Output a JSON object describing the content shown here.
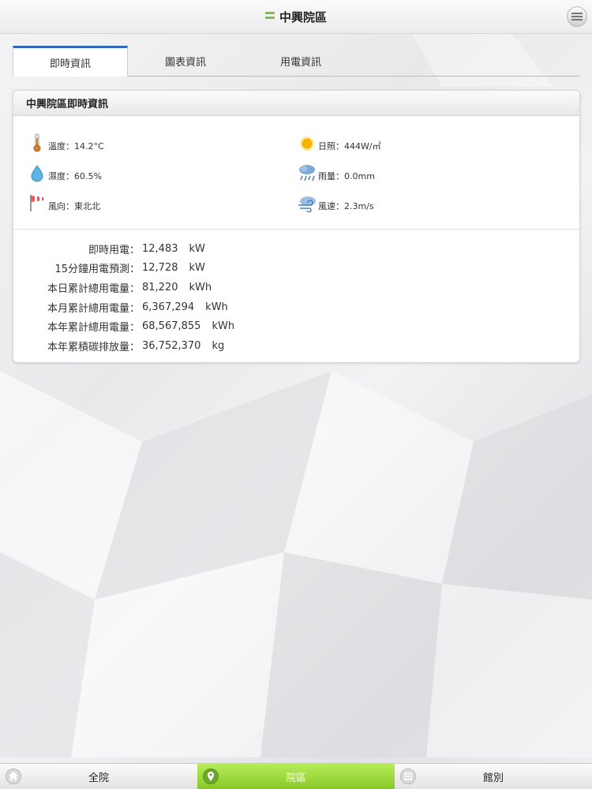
{
  "header": {
    "title": "中興院區"
  },
  "tabs": [
    {
      "label": "即時資訊",
      "active": true
    },
    {
      "label": "圖表資訊",
      "active": false
    },
    {
      "label": "用電資訊",
      "active": false
    }
  ],
  "panel": {
    "title": "中興院區即時資訊",
    "weather": {
      "temperature": "溫度：14.2°C",
      "humidity": "濕度：60.5%",
      "wind_direction": "風向：東北北",
      "sunshine": "日照：444W/㎡",
      "rainfall": "雨量：0.0mm",
      "wind_speed": "風速：2.3m/s"
    },
    "energy": [
      {
        "label": "即時用電：",
        "value": "12,483",
        "unit": "kW"
      },
      {
        "label": "15分鐘用電預測：",
        "value": "12,728",
        "unit": "kW"
      },
      {
        "label": "本日累計總用電量：",
        "value": "81,220",
        "unit": "kWh"
      },
      {
        "label": "本月累計總用電量：",
        "value": "6,367,294",
        "unit": "kWh"
      },
      {
        "label": "本年累計總用電量：",
        "value": "68,567,855",
        "unit": "kWh"
      },
      {
        "label": "本年累積碳排放量：",
        "value": "36,752,370",
        "unit": "kg"
      }
    ]
  },
  "bottom_nav": [
    {
      "label": "全院",
      "icon": "home-icon",
      "active": false
    },
    {
      "label": "院區",
      "icon": "location-pin-icon",
      "active": true
    },
    {
      "label": "館別",
      "icon": "grid-icon",
      "active": false
    }
  ],
  "colors": {
    "accent": "#2a6ab8",
    "active_nav": "#9bd83a"
  }
}
